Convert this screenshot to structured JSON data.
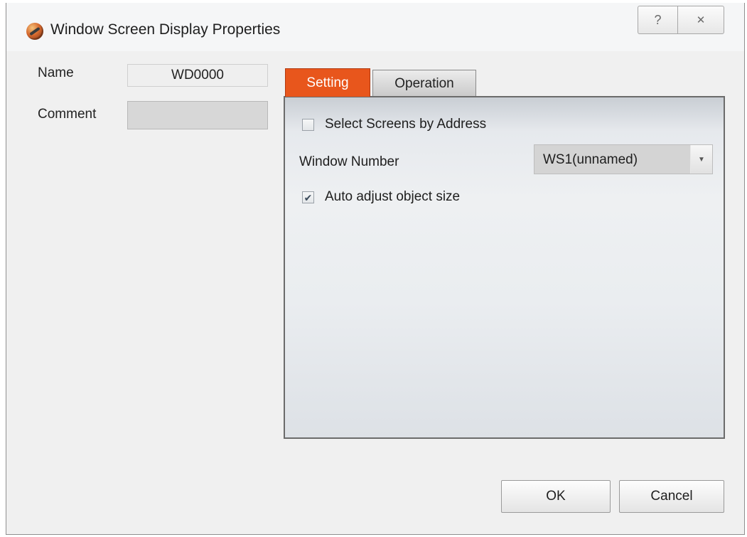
{
  "window": {
    "title": "Window Screen Display Properties",
    "icon": "app-icon",
    "help_glyph": "?",
    "close_glyph": "✕"
  },
  "fields": {
    "name_label": "Name",
    "name_value": "WD0000",
    "comment_label": "Comment",
    "comment_value": ""
  },
  "tabs": [
    {
      "label": "Setting",
      "active": true
    },
    {
      "label": "Operation",
      "active": false
    }
  ],
  "setting": {
    "select_by_address": {
      "label": "Select Screens by Address",
      "checked": false
    },
    "window_number": {
      "label": "Window Number",
      "value": "WS1(unnamed)"
    },
    "auto_adjust": {
      "label": "Auto adjust object size",
      "checked": true,
      "check_glyph": "✔"
    }
  },
  "buttons": {
    "ok": "OK",
    "cancel": "Cancel"
  },
  "colors": {
    "active_tab": "#e8561c"
  }
}
